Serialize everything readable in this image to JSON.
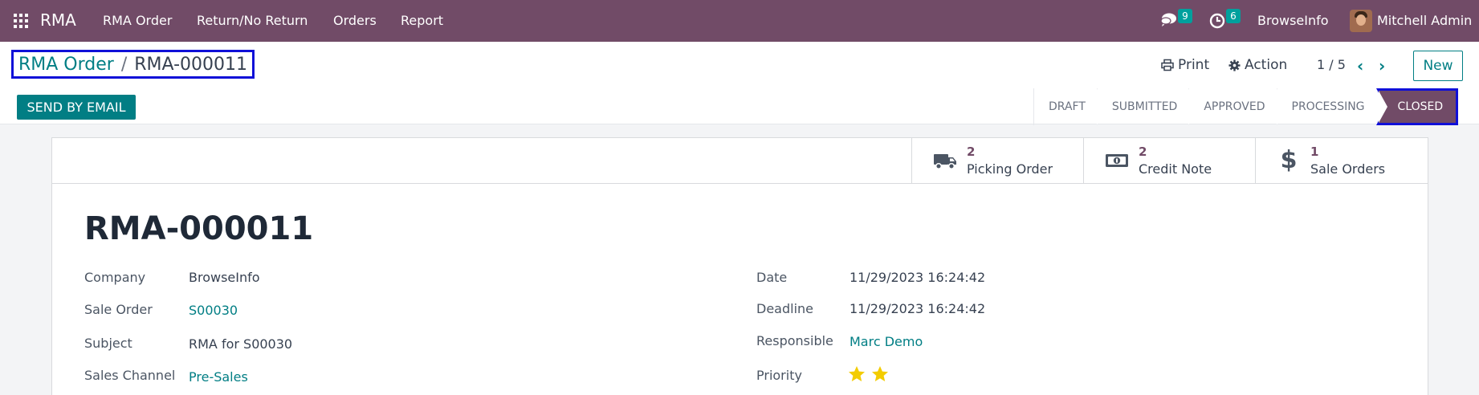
{
  "nav": {
    "app_name": "RMA",
    "menu": [
      "RMA Order",
      "Return/No Return",
      "Orders",
      "Report"
    ],
    "messages_count": "9",
    "activities_count": "6",
    "company": "BrowseInfo",
    "user": "Mitchell Admin"
  },
  "breadcrumb": {
    "parent": "RMA Order",
    "separator": "/",
    "current": "RMA-000011"
  },
  "actions": {
    "print": "Print",
    "action": "Action",
    "pager": "1 / 5",
    "new": "New",
    "send_email": "SEND BY EMAIL"
  },
  "stages": [
    "DRAFT",
    "SUBMITTED",
    "APPROVED",
    "PROCESSING",
    "CLOSED"
  ],
  "active_stage": "CLOSED",
  "smart_buttons": [
    {
      "value": "2",
      "label": "Picking Order",
      "icon": "truck-icon"
    },
    {
      "value": "2",
      "label": "Credit Note",
      "icon": "money-icon"
    },
    {
      "value": "1",
      "label": "Sale Orders",
      "icon": "dollar-icon"
    }
  ],
  "record": {
    "title": "RMA-000011",
    "fields_left": [
      {
        "label": "Company",
        "value": "BrowseInfo"
      },
      {
        "label": "Sale Order",
        "value": "S00030"
      },
      {
        "label": "Subject",
        "value": "RMA for S00030"
      },
      {
        "label": "Sales Channel",
        "value": "Pre-Sales"
      }
    ],
    "fields_right": [
      {
        "label": "Date",
        "value": "11/29/2023 16:24:42"
      },
      {
        "label": "Deadline",
        "value": "11/29/2023 16:24:42"
      },
      {
        "label": "Responsible",
        "value": "Marc Demo"
      },
      {
        "label": "Priority",
        "value": ""
      }
    ],
    "priority_stars": 2
  },
  "colors": {
    "brand": "#714b67",
    "accent": "#017e84",
    "star": "#f3cc00",
    "highlight": "#1010d8"
  }
}
